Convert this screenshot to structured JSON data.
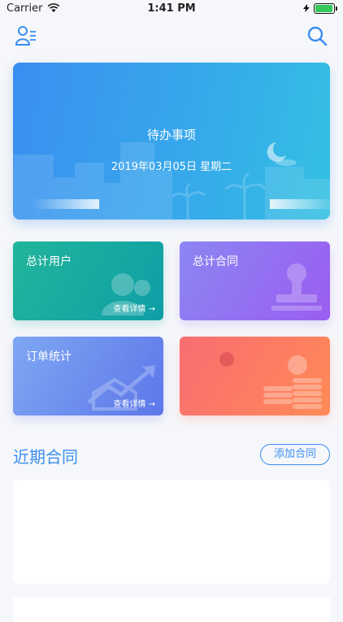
{
  "status": {
    "carrier": "Carrier",
    "time": "1:41 PM"
  },
  "header": {
    "left_icon": "user-list-icon",
    "right_icon": "search-icon"
  },
  "hero": {
    "title": "待办事项",
    "date": "2019年03月05日 星期二"
  },
  "cards": [
    {
      "title": "总计用户",
      "link": "查看详情",
      "icon": "users-icon"
    },
    {
      "title": "总计合同",
      "link": "",
      "icon": "stamp-icon"
    },
    {
      "title": "订单统计",
      "link": "查看详情",
      "icon": "chart-icon"
    },
    {
      "title": "",
      "link": "",
      "icon": "coins-icon"
    }
  ],
  "recent": {
    "title": "近期合同",
    "add_label": "添加合同"
  },
  "colors": {
    "accent": "#3a8ff0"
  }
}
